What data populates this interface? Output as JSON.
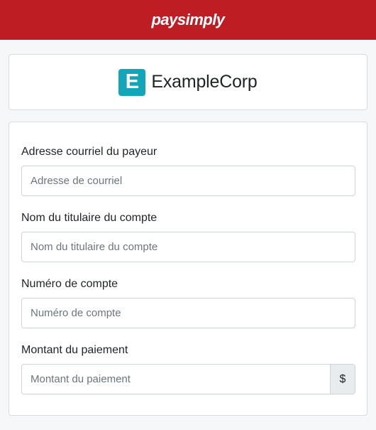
{
  "header": {
    "brand": "paysimply"
  },
  "company": {
    "logo_letter": "E",
    "name": "ExampleCorp"
  },
  "form": {
    "fields": [
      {
        "label": "Adresse courriel du payeur",
        "placeholder": "Adresse de courriel",
        "value": ""
      },
      {
        "label": "Nom du titulaire du compte",
        "placeholder": "Nom du titulaire du compte",
        "value": ""
      },
      {
        "label": "Numéro de compte",
        "placeholder": "Numéro de compte",
        "value": ""
      },
      {
        "label": "Montant du paiement",
        "placeholder": "Montant du paiement",
        "value": "",
        "addon": "$"
      }
    ]
  },
  "colors": {
    "header_bg": "#be1e23",
    "logo_accent": "#13a5b8"
  }
}
